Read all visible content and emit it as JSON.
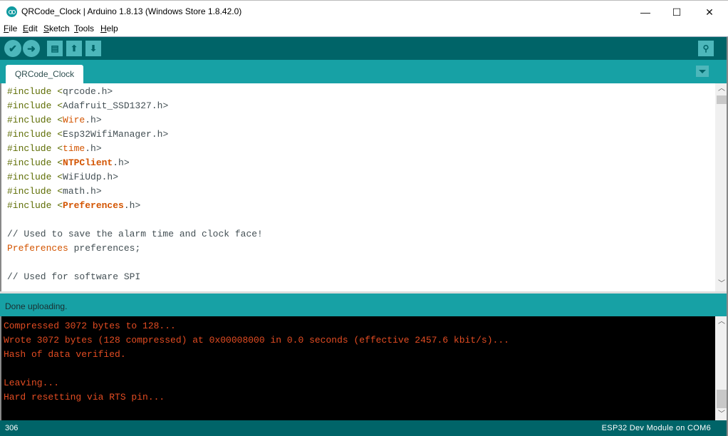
{
  "window": {
    "title": "QRCode_Clock | Arduino 1.8.13 (Windows Store 1.8.42.0)",
    "minimize_glyph": "—",
    "maximize_glyph": "☐",
    "close_glyph": "✕"
  },
  "menu": [
    {
      "key": "F",
      "rest": "ile"
    },
    {
      "key": "E",
      "rest": "dit"
    },
    {
      "key": "S",
      "rest": "ketch"
    },
    {
      "key": "T",
      "rest": "ools"
    },
    {
      "key": "H",
      "rest": "elp"
    }
  ],
  "toolbar": {
    "verify_icon": "✔",
    "upload_icon": "➜",
    "new_icon": "▤",
    "open_icon": "⬆",
    "save_icon": "⬇",
    "serial_monitor_icon": "⚲"
  },
  "tabs": [
    {
      "label": "QRCode_Clock"
    }
  ],
  "colors": {
    "toolbar_bg": "#006468",
    "tabbar_bg": "#17a1a5",
    "console_text": "#e34c22",
    "keyword_orange": "#d35400"
  },
  "code": {
    "lines": [
      {
        "pre": "#include <",
        "lib": "",
        "plain": "qrcode",
        "post": ".h>"
      },
      {
        "pre": "#include <",
        "lib": "",
        "plain": "Adafruit_SSD1327",
        "post": ".h>"
      },
      {
        "pre": "#include <",
        "lib": "Wire",
        "plain": "",
        "post": ".h>"
      },
      {
        "pre": "#include <",
        "lib": "",
        "plain": "Esp32WifiManager",
        "post": ".h>"
      },
      {
        "pre": "#include <",
        "lib": "time",
        "plain": "",
        "post": ".h>"
      },
      {
        "pre": "#include <",
        "libbold": "NTPClient",
        "plain": "",
        "post": ".h>"
      },
      {
        "pre": "#include <",
        "lib": "",
        "plain": "WiFiUdp",
        "post": ".h>"
      },
      {
        "pre": "#include <",
        "lib": "",
        "plain": "math",
        "post": ".h>"
      },
      {
        "pre": "#include <",
        "libbold": "Preferences",
        "plain": "",
        "post": ".h>"
      }
    ],
    "comment1": "// Used to save the alarm time and clock face!",
    "decl_type": "Preferences",
    "decl_rest": " preferences;",
    "comment2": "// Used for software SPI"
  },
  "status": {
    "message": "Done uploading."
  },
  "console": {
    "lines": [
      "Compressed 3072 bytes to 128...",
      "Wrote 3072 bytes (128 compressed) at 0x00008000 in 0.0 seconds (effective 2457.6 kbit/s)...",
      "Hash of data verified.",
      "",
      "Leaving...",
      "Hard resetting via RTS pin..."
    ]
  },
  "footer": {
    "line_number": "306",
    "board": "ESP32 Dev Module on COM6"
  }
}
